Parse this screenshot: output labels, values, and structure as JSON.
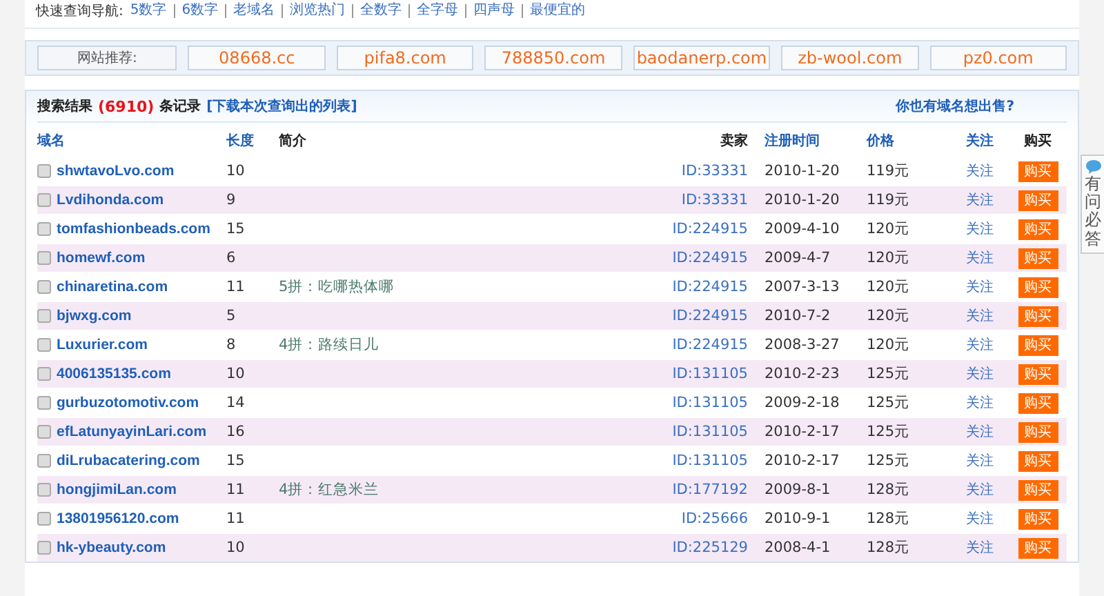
{
  "quick_nav": {
    "label": "快速查询导航:",
    "links": [
      "5数字",
      "6数字",
      "老域名",
      "浏览热门",
      "全数字",
      "全字母",
      "四声母",
      "最便宜的"
    ]
  },
  "recommend": {
    "label": "网站推荐:",
    "sites": [
      "08668.cc",
      "pifa8.com",
      "788850.com",
      "baodanerp.com",
      "zb-wool.com",
      "pz0.com"
    ]
  },
  "results": {
    "label": "搜索结果",
    "count": "(6910)",
    "unit": "条记录",
    "download_link": "[下载本次查询出的列表]",
    "sell_link": "你也有域名想出售?"
  },
  "table": {
    "columns": [
      {
        "label": "域名",
        "link": true
      },
      {
        "label": "长度",
        "link": true
      },
      {
        "label": "简介",
        "link": false
      },
      {
        "label": "卖家",
        "link": false
      },
      {
        "label": "注册时间",
        "link": true
      },
      {
        "label": "价格",
        "link": true
      },
      {
        "label": "关注",
        "link": true
      },
      {
        "label": "购买",
        "link": false
      }
    ],
    "rows": [
      {
        "checked": false,
        "domain": "shwtavoLvo.com",
        "length": "10",
        "intro": "",
        "seller": "ID:33331",
        "date": "2010-1-20",
        "price": "119元",
        "follow": "关注",
        "buy": "购买"
      },
      {
        "checked": false,
        "domain": "Lvdihonda.com",
        "length": "9",
        "intro": "",
        "seller": "ID:33331",
        "date": "2010-1-20",
        "price": "119元",
        "follow": "关注",
        "buy": "购买"
      },
      {
        "checked": false,
        "domain": "tomfashionbeads.com",
        "length": "15",
        "intro": "",
        "seller": "ID:224915",
        "date": "2009-4-10",
        "price": "120元",
        "follow": "关注",
        "buy": "购买"
      },
      {
        "checked": false,
        "domain": "homewf.com",
        "length": "6",
        "intro": "",
        "seller": "ID:224915",
        "date": "2009-4-7",
        "price": "120元",
        "follow": "关注",
        "buy": "购买"
      },
      {
        "checked": false,
        "domain": "chinaretina.com",
        "length": "11",
        "intro": "5拼：吃哪热体哪",
        "seller": "ID:224915",
        "date": "2007-3-13",
        "price": "120元",
        "follow": "关注",
        "buy": "购买"
      },
      {
        "checked": false,
        "domain": "bjwxg.com",
        "length": "5",
        "intro": "",
        "seller": "ID:224915",
        "date": "2010-7-2",
        "price": "120元",
        "follow": "关注",
        "buy": "购买"
      },
      {
        "checked": false,
        "domain": "Luxurier.com",
        "length": "8",
        "intro": "4拼：路续日儿",
        "seller": "ID:224915",
        "date": "2008-3-27",
        "price": "120元",
        "follow": "关注",
        "buy": "购买"
      },
      {
        "checked": false,
        "domain": "4006135135.com",
        "length": "10",
        "intro": "",
        "seller": "ID:131105",
        "date": "2010-2-23",
        "price": "125元",
        "follow": "关注",
        "buy": "购买"
      },
      {
        "checked": false,
        "domain": "gurbuzotomotiv.com",
        "length": "14",
        "intro": "",
        "seller": "ID:131105",
        "date": "2009-2-18",
        "price": "125元",
        "follow": "关注",
        "buy": "购买"
      },
      {
        "checked": false,
        "domain": "efLatunyayinLari.com",
        "length": "16",
        "intro": "",
        "seller": "ID:131105",
        "date": "2010-2-17",
        "price": "125元",
        "follow": "关注",
        "buy": "购买"
      },
      {
        "checked": false,
        "domain": "diLrubacatering.com",
        "length": "15",
        "intro": "",
        "seller": "ID:131105",
        "date": "2010-2-17",
        "price": "125元",
        "follow": "关注",
        "buy": "购买"
      },
      {
        "checked": false,
        "domain": "hongjimiLan.com",
        "length": "11",
        "intro": "4拼：红急米兰",
        "seller": "ID:177192",
        "date": "2009-8-1",
        "price": "128元",
        "follow": "关注",
        "buy": "购买"
      },
      {
        "checked": false,
        "domain": "13801956120.com",
        "length": "11",
        "intro": "",
        "seller": "ID:25666",
        "date": "2010-9-1",
        "price": "128元",
        "follow": "关注",
        "buy": "购买"
      },
      {
        "checked": false,
        "domain": "hk-ybeauty.com",
        "length": "10",
        "intro": "",
        "seller": "ID:225129",
        "date": "2008-4-1",
        "price": "128元",
        "follow": "关注",
        "buy": "购买"
      }
    ]
  },
  "side_tab": {
    "label": "有问必答"
  }
}
